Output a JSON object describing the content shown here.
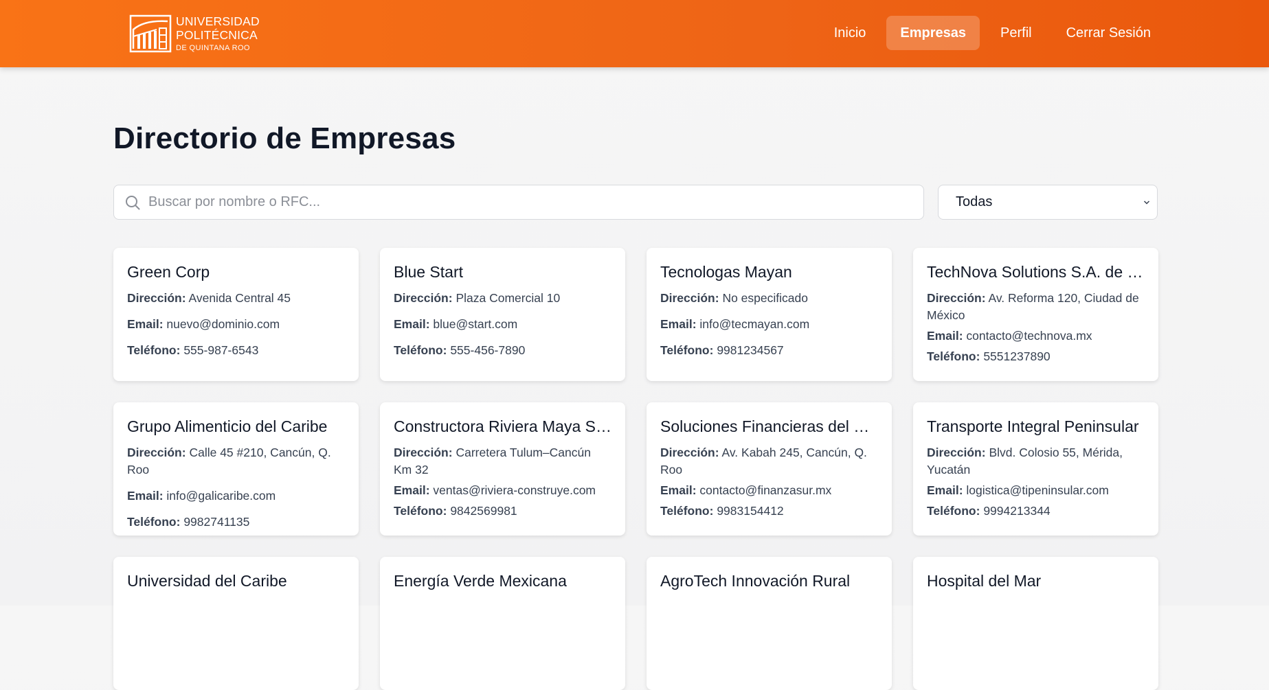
{
  "brand": {
    "line1": "UNIVERSIDAD",
    "line2": "POLITÉCNICA",
    "line3": "DE QUINTANA ROO"
  },
  "nav": {
    "items": [
      {
        "label": "Inicio"
      },
      {
        "label": "Empresas"
      },
      {
        "label": "Perfil"
      },
      {
        "label": "Cerrar Sesión"
      }
    ],
    "active": "Empresas"
  },
  "page": {
    "title": "Directorio de Empresas"
  },
  "search": {
    "placeholder": "Buscar por nombre o RFC...",
    "value": ""
  },
  "filter": {
    "selected": "Todas"
  },
  "labels": {
    "address": "Dirección:",
    "email": "Email:",
    "phone": "Teléfono:"
  },
  "companies": [
    {
      "name": "Green Corp",
      "address": "Avenida Central 45",
      "email": "nuevo@dominio.com",
      "phone": "555-987-6543"
    },
    {
      "name": "Blue Start",
      "address": "Plaza Comercial 10",
      "email": "blue@start.com",
      "phone": "555-456-7890"
    },
    {
      "name": "Tecnologas Mayan",
      "address": "No especificado",
      "email": "info@tecmayan.com",
      "phone": "9981234567"
    },
    {
      "name": "TechNova Solutions S.A. de C...",
      "address": "Av. Reforma 120, Ciudad de México",
      "email": "contacto@technova.mx",
      "phone": "5551237890"
    },
    {
      "name": "Grupo Alimenticio del Caribe",
      "address": "Calle 45 #210, Cancún, Q. Roo",
      "email": "info@galicaribe.com",
      "phone": "9982741135"
    },
    {
      "name": "Constructora Riviera Maya S.A.",
      "address": "Carretera Tulum–Cancún Km 32",
      "email": "ventas@riviera-construye.com",
      "phone": "9842569981"
    },
    {
      "name": "Soluciones Financieras del Su...",
      "address": "Av. Kabah 245, Cancún, Q. Roo",
      "email": "contacto@finanzasur.mx",
      "phone": "9983154412"
    },
    {
      "name": "Transporte Integral Peninsular",
      "address": "Blvd. Colosio 55, Mérida, Yucatán",
      "email": "logistica@tipeninsular.com",
      "phone": "9994213344"
    },
    {
      "name": "Universidad del Caribe"
    },
    {
      "name": "Energía Verde Mexicana"
    },
    {
      "name": "AgroTech Innovación Rural"
    },
    {
      "name": "Hospital del Mar"
    }
  ]
}
